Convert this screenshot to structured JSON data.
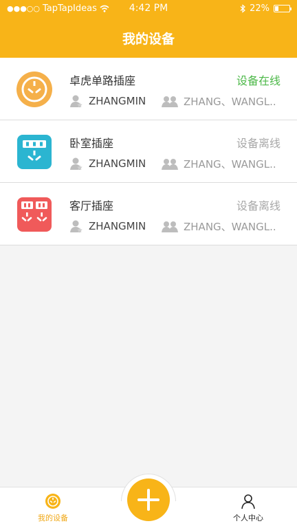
{
  "status_bar": {
    "carrier": "TapTapIdeas",
    "time": "4:42 PM",
    "battery": "22%",
    "battery_level": 0.22
  },
  "header": {
    "title": "我的设备"
  },
  "devices": [
    {
      "name": "卓虎单路插座",
      "status": "设备在线",
      "status_color": "#4cb848",
      "owner": "ZHANGMIN",
      "shared": "ZHANG、WANGL..",
      "icon": "round-socket-icon",
      "icon_color": "#f5b04a"
    },
    {
      "name": "卧室插座",
      "status": "设备离线",
      "status_color": "#a8a8a8",
      "owner": "ZHANGMIN",
      "shared": "ZHANG、WANGL..",
      "icon": "display-socket-icon",
      "icon_color": "#2bb5d1"
    },
    {
      "name": "客厅插座",
      "status": "设备离线",
      "status_color": "#a8a8a8",
      "owner": "ZHANGMIN",
      "shared": "ZHANG、WANGL..",
      "icon": "double-socket-icon",
      "icon_color": "#f05a5a"
    }
  ],
  "tabbar": {
    "devices_label": "我的设备",
    "profile_label": "个人中心",
    "active_color": "#f0a818"
  }
}
